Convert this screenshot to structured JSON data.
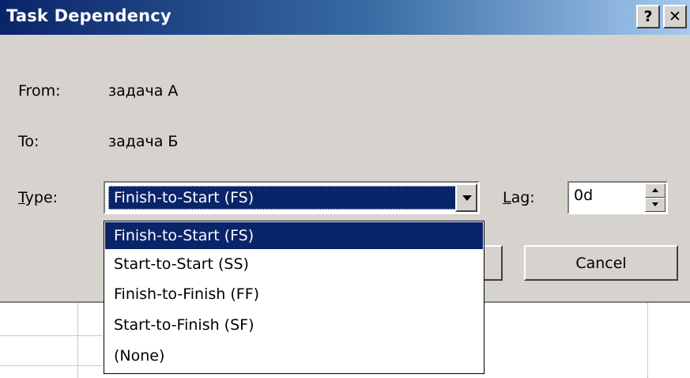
{
  "dialog": {
    "title": "Task Dependency",
    "help_button": "?",
    "close_button": "✕"
  },
  "fields": {
    "from_label": "From:",
    "from_value": "задача А",
    "to_label": "To:",
    "to_value": "задача Б",
    "type_label_accel": "T",
    "type_label_rest": "ype:",
    "type_selected": "Finish-to-Start (FS)",
    "lag_label_accel": "L",
    "lag_label_rest": "ag:",
    "lag_value": "0d"
  },
  "buttons": {
    "cancel": "Cancel"
  },
  "type_options": [
    "Finish-to-Start (FS)",
    "Start-to-Start (SS)",
    "Finish-to-Finish (FF)",
    "Start-to-Finish (SF)",
    "(None)"
  ],
  "icons": [
    "help-icon",
    "close-icon",
    "dropdown-arrow-icon",
    "spin-up-icon",
    "spin-down-icon"
  ],
  "colors": {
    "title_start": "#0a246a",
    "title_end": "#a6caf0",
    "dialog_bg": "#d6d3ce",
    "selection": "#0a246a"
  }
}
